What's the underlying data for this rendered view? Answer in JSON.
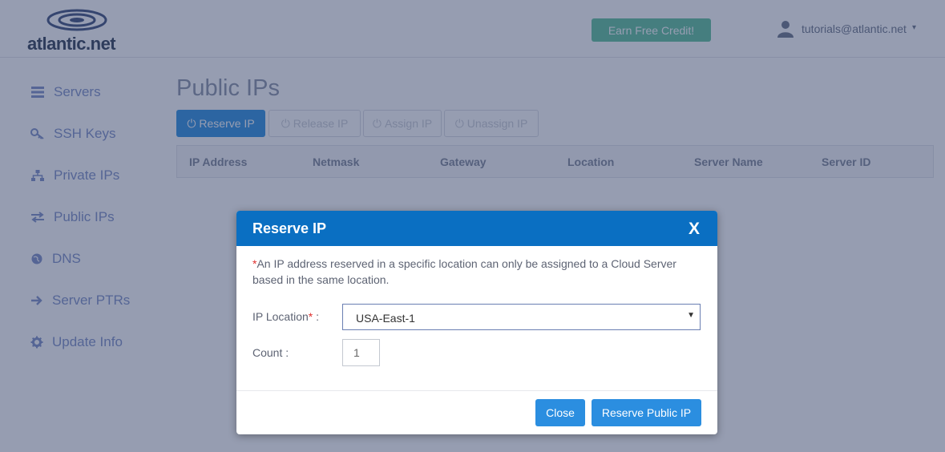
{
  "header": {
    "logo_text": "atlantic.net",
    "earn_credit_label": "Earn Free Credit!",
    "user_email": "tutorials@atlantic.net",
    "user_menu_caret": "▾"
  },
  "sidebar": {
    "items": [
      {
        "label": "Servers",
        "icon": "server-icon"
      },
      {
        "label": "SSH Keys",
        "icon": "key-icon"
      },
      {
        "label": "Private IPs",
        "icon": "network-icon"
      },
      {
        "label": "Public IPs",
        "icon": "exchange-icon"
      },
      {
        "label": "DNS",
        "icon": "globe-icon"
      },
      {
        "label": "Server PTRs",
        "icon": "arrow-right-icon"
      },
      {
        "label": "Update Info",
        "icon": "gear-icon"
      }
    ]
  },
  "main": {
    "title": "Public IPs",
    "toolbar": {
      "reserve_label": "Reserve IP",
      "release_label": "Release IP",
      "assign_label": "Assign IP",
      "unassign_label": "Unassign IP"
    },
    "table": {
      "columns": [
        "IP Address",
        "Netmask",
        "Gateway",
        "Location",
        "Server Name",
        "Server ID"
      ]
    }
  },
  "modal": {
    "title": "Reserve IP",
    "close_x": "X",
    "note_asterisk": "*",
    "note": "An IP address reserved in a specific location can only be assigned to a Cloud Server based in the same location.",
    "location_label": "IP Location",
    "location_required": "*",
    "location_colon": " :",
    "location_value": "USA-East-1",
    "count_label": "Count :",
    "count_value": "1",
    "close_button": "Close",
    "reserve_button": "Reserve Public IP"
  },
  "colors": {
    "brand_blue": "#0a6fc2",
    "button_blue": "#2b8ee0",
    "earn_green": "#5cc09a",
    "required_red": "#e0312f"
  }
}
